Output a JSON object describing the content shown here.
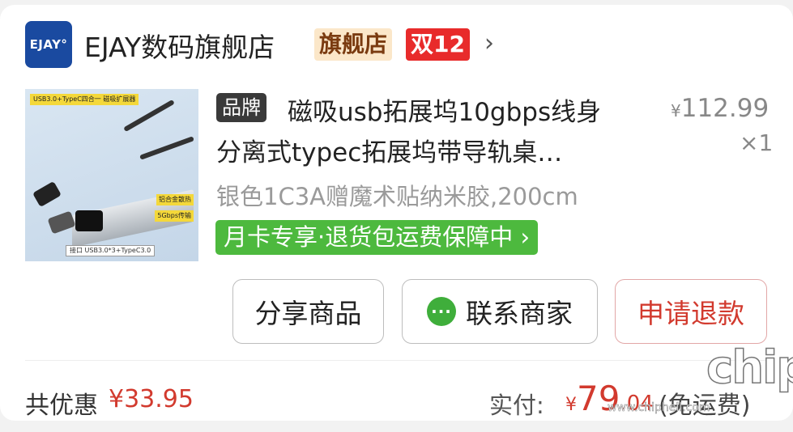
{
  "store": {
    "logo_text": "EJAY°",
    "name": "EJAY数码旗舰店",
    "flagship_badge": "旗舰店",
    "event_badge": "双12"
  },
  "product": {
    "image_labels": {
      "top": "USB3.0+TypeC四合一 磁吸扩展器",
      "side1": "铝合金散热",
      "side2": "5Gbps传输",
      "bottom": "接口 USB3.0*3+TypeC3.0"
    },
    "brand_tag": "品牌",
    "title_line1": "磁吸usb拓展坞10gbps线身",
    "title_line2": "分离式typec拓展坞带导轨桌…",
    "price_symbol": "¥",
    "price_value": "112.99",
    "quantity": "×1",
    "spec": "银色1C3A赠魔术贴纳米胶,200cm",
    "promo": "月卡专享·退货包运费保障中"
  },
  "actions": {
    "share": "分享商品",
    "contact": "联系商家",
    "refund": "申请退款"
  },
  "summary": {
    "discount_label": "共优惠",
    "discount_value": "¥33.95",
    "paid_label": "实付:",
    "paid_symbol": "¥",
    "paid_int": "79",
    "paid_dec": ".04",
    "shipping_note": "(免运费)"
  },
  "watermark": {
    "brand": "chip",
    "url": "www.chiphell.com"
  },
  "colors": {
    "accent_red": "#d23a2e",
    "promo_green": "#4db93e",
    "logo_blue": "#1a4aa0"
  }
}
